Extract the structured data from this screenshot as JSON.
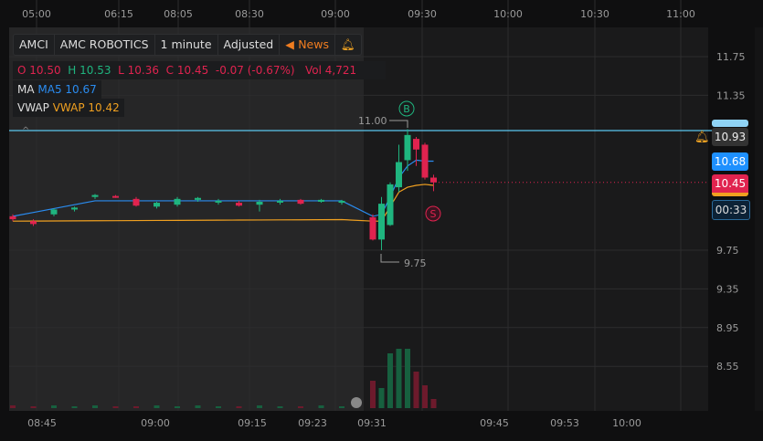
{
  "header": {
    "symbol": "AMCI",
    "name": "AMC ROBOTICS",
    "interval": "1 minute",
    "adjust": "Adjusted",
    "news": "News"
  },
  "ohlc": {
    "o_label": "O",
    "o": "10.50",
    "h_label": "H",
    "h": "10.53",
    "l_label": "L",
    "l": "10.36",
    "c_label": "C",
    "c": "10.45",
    "change": "-0.07 (-0.67%)",
    "vol_label": "Vol",
    "vol": "4,721"
  },
  "ma": {
    "label": "MA",
    "value": "MA5 10.67"
  },
  "vwap": {
    "label": "VWAP",
    "value": "VWAP 10.42"
  },
  "price_axis": [
    "11.75",
    "11.35",
    "9.75",
    "9.35",
    "8.95",
    "8.55"
  ],
  "tags": {
    "alert": "10.93",
    "ma": "10.68",
    "last": "10.45",
    "timer": "00:33"
  },
  "annotations": {
    "high": "11.00",
    "low": "9.75",
    "buy": "B",
    "sell": "S"
  },
  "top_times": [
    "05:00",
    "06:15",
    "08:05",
    "08:30",
    "09:00",
    "09:30",
    "10:00",
    "10:30",
    "11:00"
  ],
  "bottom_times": [
    "08:45",
    "09:00",
    "09:15",
    "09:23",
    "09:31",
    "09:45",
    "09:53",
    "10:00"
  ],
  "colors": {
    "up": "#1fb57f",
    "down": "#e0234f",
    "ma": "#2a8cf0",
    "vwap": "#f0a020",
    "alert": "#5bc8f0"
  },
  "chart_data": {
    "type": "candlestick",
    "candles": [
      [
        10.1,
        10.12,
        10.05,
        10.07
      ],
      [
        10.05,
        10.07,
        10.0,
        10.02
      ],
      [
        10.12,
        10.18,
        10.1,
        10.17
      ],
      [
        10.17,
        10.2,
        10.15,
        10.19
      ],
      [
        10.3,
        10.33,
        10.28,
        10.32
      ],
      [
        10.31,
        10.32,
        10.29,
        10.3
      ],
      [
        10.28,
        10.3,
        10.2,
        10.21
      ],
      [
        10.2,
        10.25,
        10.18,
        10.24
      ],
      [
        10.22,
        10.3,
        10.2,
        10.28
      ],
      [
        10.27,
        10.3,
        10.25,
        10.29
      ],
      [
        10.25,
        10.28,
        10.22,
        10.26
      ],
      [
        10.24,
        10.26,
        10.2,
        10.21
      ],
      [
        10.22,
        10.27,
        10.15,
        10.25
      ],
      [
        10.25,
        10.28,
        10.22,
        10.26
      ],
      [
        10.27,
        10.28,
        10.22,
        10.23
      ],
      [
        10.25,
        10.28,
        10.24,
        10.27
      ],
      [
        10.24,
        10.27,
        10.22,
        10.26
      ],
      [
        10.09,
        10.12,
        9.85,
        9.86
      ],
      [
        9.86,
        10.3,
        9.75,
        10.23
      ],
      [
        10.01,
        10.45,
        10.0,
        10.43
      ],
      [
        10.4,
        10.84,
        10.35,
        10.66
      ],
      [
        10.68,
        11.0,
        10.57,
        10.94
      ],
      [
        10.9,
        10.92,
        10.62,
        10.79
      ],
      [
        10.84,
        10.86,
        10.48,
        10.5
      ],
      [
        10.5,
        10.53,
        10.36,
        10.45
      ]
    ],
    "volume": [
      3,
      2,
      3,
      2,
      3,
      2,
      2,
      3,
      2,
      3,
      2,
      2,
      3,
      2,
      2,
      3,
      2,
      30,
      22,
      60,
      65,
      65,
      40,
      25,
      10
    ]
  }
}
